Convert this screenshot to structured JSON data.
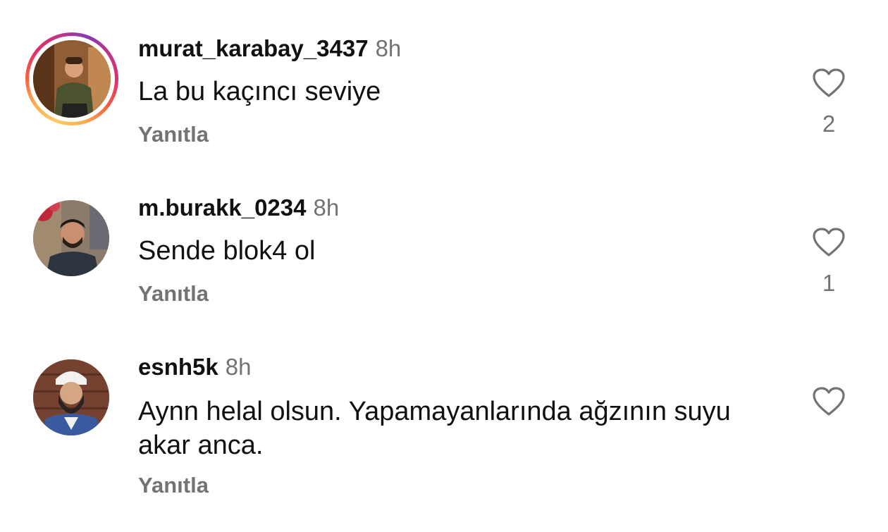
{
  "comments": [
    {
      "username": "murat_karabay_3437",
      "time": "8h",
      "text": "La bu kaçıncı seviye",
      "reply_label": "Yanıtla",
      "like_count": "2",
      "has_story": true
    },
    {
      "username": "m.burakk_0234",
      "time": "8h",
      "text": "Sende blok4 ol",
      "reply_label": "Yanıtla",
      "like_count": "1",
      "has_story": false
    },
    {
      "username": "esnh5k",
      "time": "8h",
      "text": "Aynn helal olsun. Yapamayanlarında ağzının suyu akar anca.",
      "reply_label": "Yanıtla",
      "like_count": "",
      "has_story": false
    }
  ],
  "icons": {
    "like": "heart-outline-icon"
  },
  "colors": {
    "username": "#111111",
    "secondary_text": "#737373",
    "story_ring_start": "#fccc63",
    "story_ring_end": "#c13584"
  }
}
